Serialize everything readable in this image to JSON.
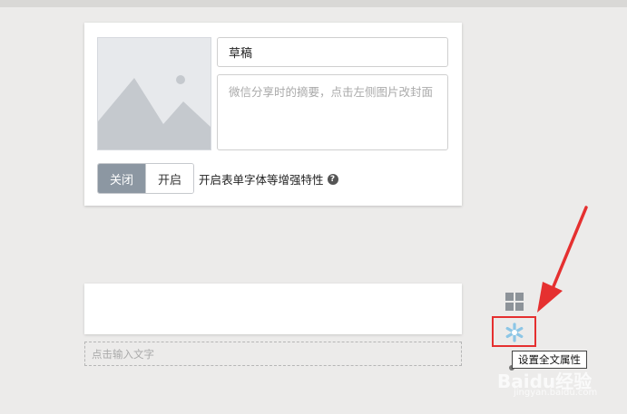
{
  "article": {
    "title_value": "草稿",
    "summary_placeholder": "微信分享时的摘要，点击左侧图片改封面",
    "toggle": {
      "off_label": "关闭",
      "on_label": "开启",
      "selected": "off"
    },
    "enhance_label": "开启表单字体等增强特性",
    "help_icon": "question-circle-icon"
  },
  "text_section": {
    "input_placeholder": "点击输入文字"
  },
  "side_tools": {
    "grid_icon": "grid-icon",
    "settings_icon": "snowflake-gear-icon",
    "tooltip": "设置全文属性"
  },
  "annotation": {
    "highlight_color": "#e53030"
  },
  "watermark": {
    "text": "Baidu经验",
    "url": "jingyan.baidu.com"
  }
}
